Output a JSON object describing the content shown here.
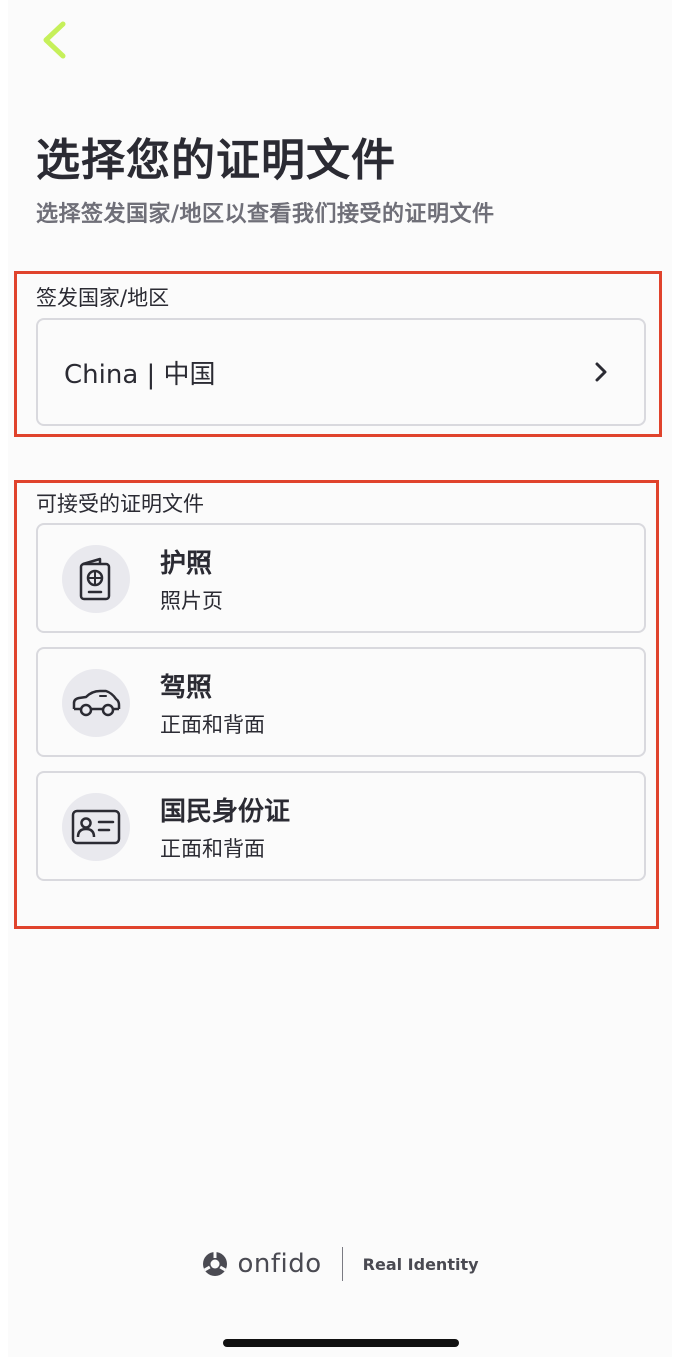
{
  "header": {
    "title": "选择您的证明文件",
    "subtitle": "选择签发国家/地区以查看我们接受的证明文件",
    "back_icon": "chevron-left-icon",
    "accent_color": "#c6f05a"
  },
  "country": {
    "label": "签发国家/地区",
    "value": "China | 中国",
    "chevron_icon": "chevron-right-icon"
  },
  "documents": {
    "label": "可接受的证明文件",
    "items": [
      {
        "title": "护照",
        "subtitle": "照片页",
        "icon": "passport-icon"
      },
      {
        "title": "驾照",
        "subtitle": "正面和背面",
        "icon": "car-icon"
      },
      {
        "title": "国民身份证",
        "subtitle": "正面和背面",
        "icon": "id-card-icon"
      }
    ]
  },
  "footer": {
    "brand": "onfido",
    "tagline": "Real Identity",
    "logo_icon": "onfido-logo-icon"
  },
  "annotation_color": "#e0432c"
}
